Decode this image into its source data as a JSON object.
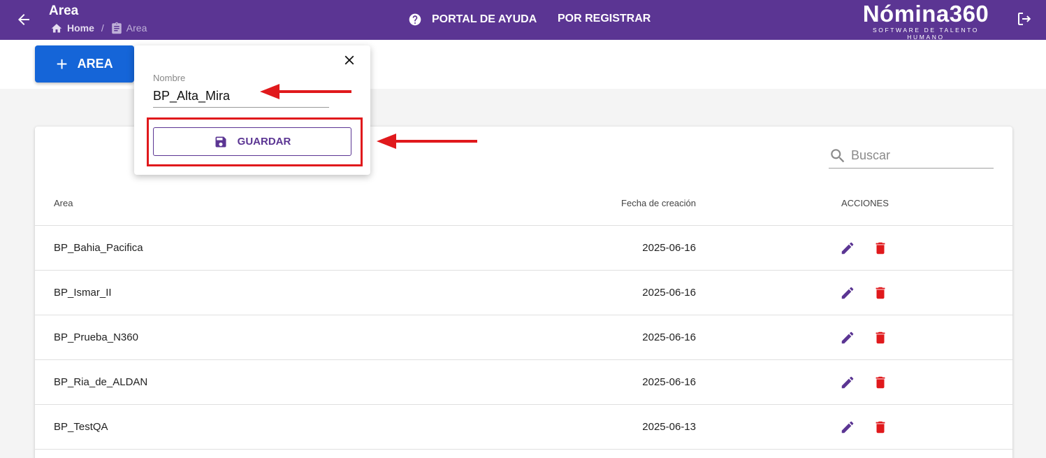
{
  "header": {
    "title": "Area",
    "breadcrumb_home": "Home",
    "breadcrumb_current": "Area",
    "nav_help": "PORTAL DE AYUDA",
    "nav_register": "POR REGISTRAR",
    "logo_main": "Nómina360",
    "logo_sub": "SOFTWARE DE TALENTO HUMANO"
  },
  "toolbar": {
    "add_label": "AREA"
  },
  "popup": {
    "field_label": "Nombre",
    "field_value": "BP_Alta_Mira",
    "save_label": "GUARDAR"
  },
  "search": {
    "placeholder": "Buscar"
  },
  "table": {
    "columns": [
      "Area",
      "Fecha de creación",
      "ACCIONES"
    ],
    "rows": [
      {
        "name": "BP_Bahia_Pacifica",
        "date": "2025-06-16"
      },
      {
        "name": "BP_Ismar_II",
        "date": "2025-06-16"
      },
      {
        "name": "BP_Prueba_N360",
        "date": "2025-06-16"
      },
      {
        "name": "BP_Ria_de_ALDAN",
        "date": "2025-06-16"
      },
      {
        "name": "BP_TestQA",
        "date": "2025-06-13"
      }
    ]
  },
  "colors": {
    "header_bg": "#5b3593",
    "primary_button": "#1565d8",
    "edit_icon": "#5b3593",
    "delete_icon": "#e0191c",
    "annotation": "#e0191c"
  }
}
